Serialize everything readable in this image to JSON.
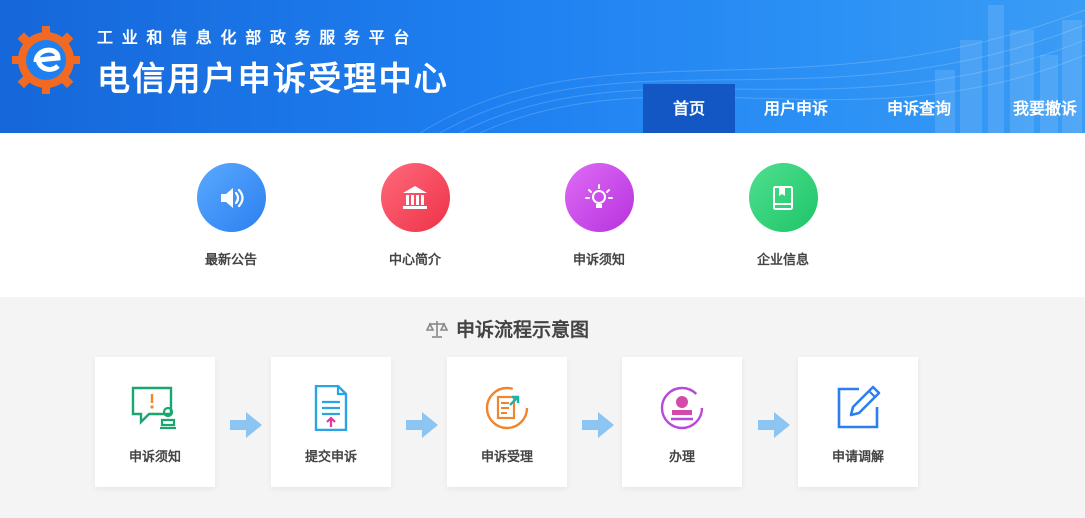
{
  "header": {
    "subtitle": "工业和信息化部政务服务平台",
    "title": "电信用户申诉受理中心",
    "accent_color": "#1e7ff0"
  },
  "nav": {
    "items": [
      {
        "label": "首页",
        "active": true
      },
      {
        "label": "用户申诉",
        "active": false
      },
      {
        "label": "申诉查询",
        "active": false
      },
      {
        "label": "我要撤诉",
        "active": false
      }
    ]
  },
  "quick_links": [
    {
      "label": "最新公告",
      "icon": "speaker-icon",
      "color": "#3b8ef5"
    },
    {
      "label": "中心简介",
      "icon": "institution-icon",
      "color": "#f2465d"
    },
    {
      "label": "申诉须知",
      "icon": "lightbulb-icon",
      "color": "#c94ae6"
    },
    {
      "label": "企业信息",
      "icon": "book-icon",
      "color": "#2bd17a"
    }
  ],
  "process": {
    "title": "申诉流程示意图",
    "steps": [
      {
        "label": "申诉须知",
        "icon": "notice-chat-icon"
      },
      {
        "label": "提交申诉",
        "icon": "document-upload-icon"
      },
      {
        "label": "申诉受理",
        "icon": "document-accept-icon"
      },
      {
        "label": "办理",
        "icon": "stamp-icon"
      },
      {
        "label": "申请调解",
        "icon": "edit-icon"
      }
    ]
  }
}
